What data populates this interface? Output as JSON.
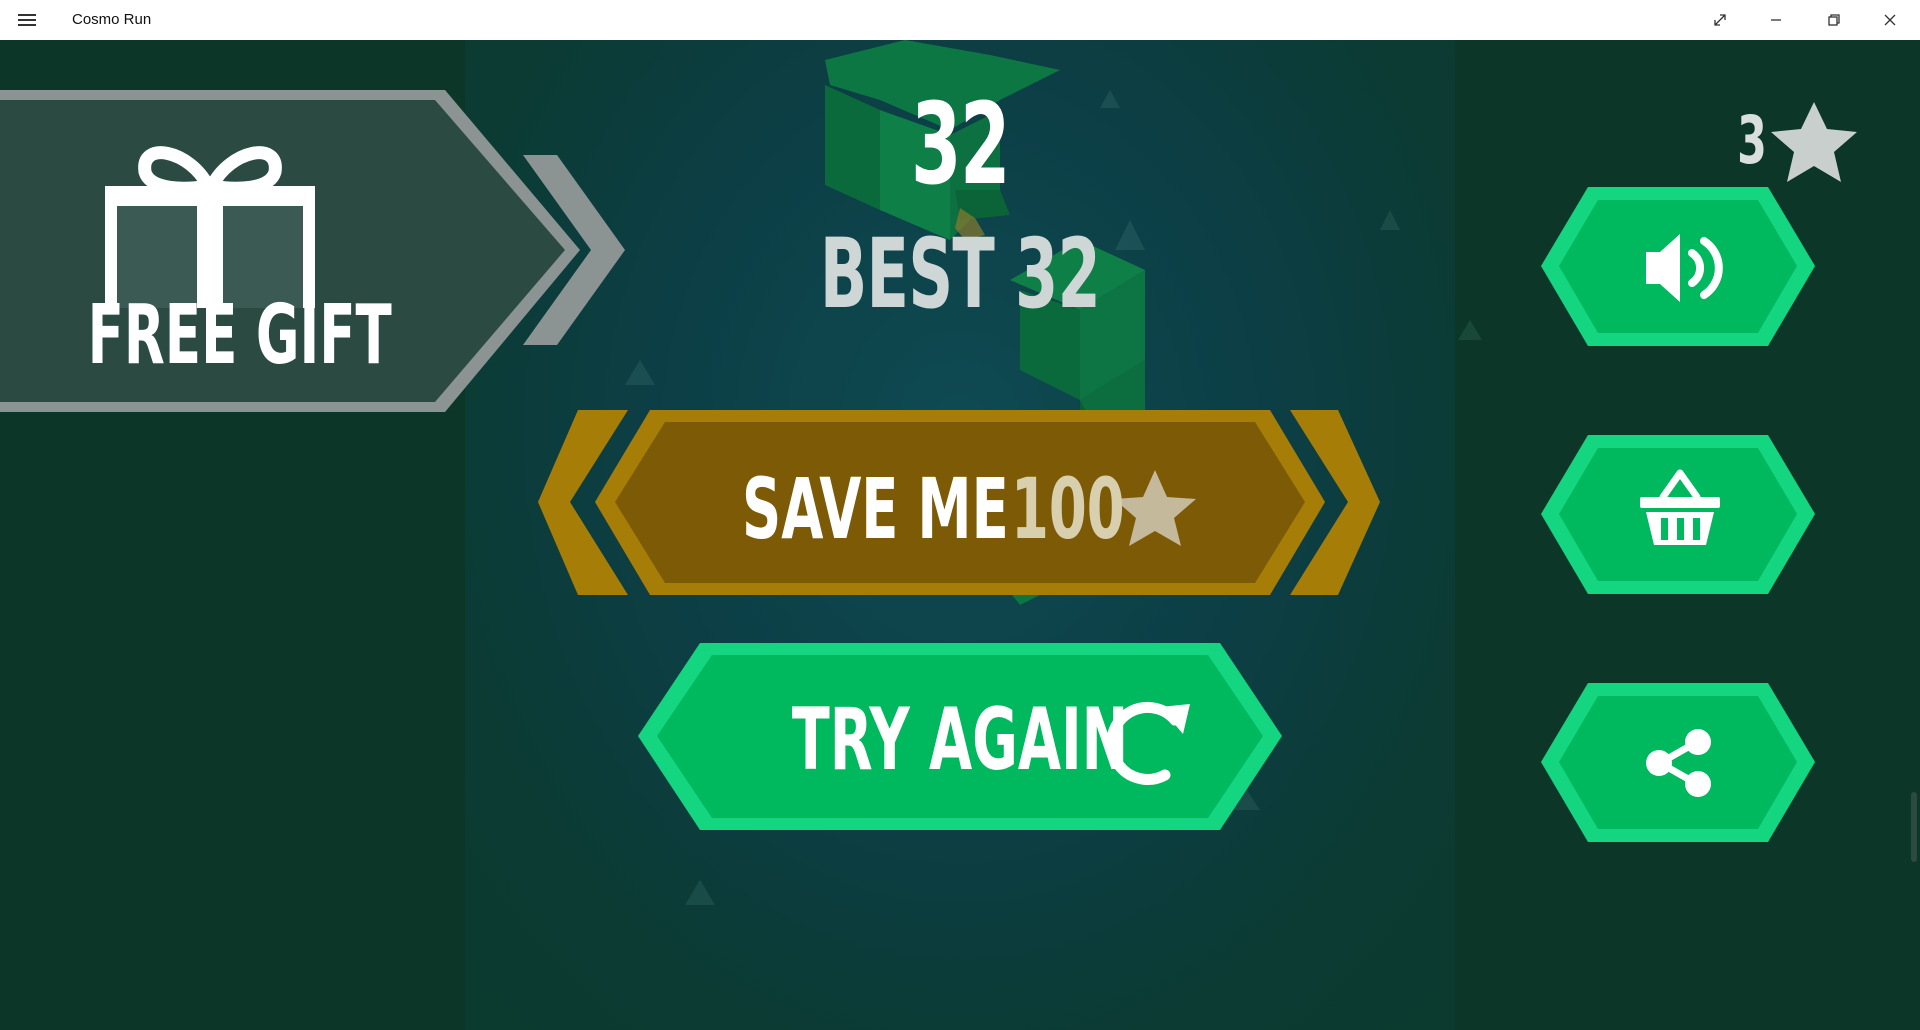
{
  "window": {
    "title": "Cosmo Run",
    "menu_icon": "hamburger-icon",
    "controls": [
      "expand-icon",
      "minimize-icon",
      "restore-icon",
      "close-icon"
    ]
  },
  "game": {
    "score": "32",
    "best": "BEST 32",
    "stars_owned": "3",
    "free_gift": {
      "label": "FREE GIFT",
      "icon": "gift-icon"
    },
    "save_me": {
      "label": "SAVE ME",
      "cost": "100",
      "icon": "star-icon"
    },
    "try_again": {
      "label": "TRY AGAIN",
      "icon": "refresh-icon"
    },
    "side_buttons": [
      {
        "name": "sound",
        "icon": "speaker-icon"
      },
      {
        "name": "shop",
        "icon": "basket-icon"
      },
      {
        "name": "share",
        "icon": "share-icon"
      }
    ]
  },
  "colors": {
    "background": "#0b3628",
    "panel": "#0c3e45",
    "gold": "#a57e08",
    "gold_inner": "#7f5c06",
    "green": "#00c66a",
    "green_inner": "#00b55c",
    "gift_panel": "#2b4a42",
    "gray_chevron": "#8a9391"
  }
}
